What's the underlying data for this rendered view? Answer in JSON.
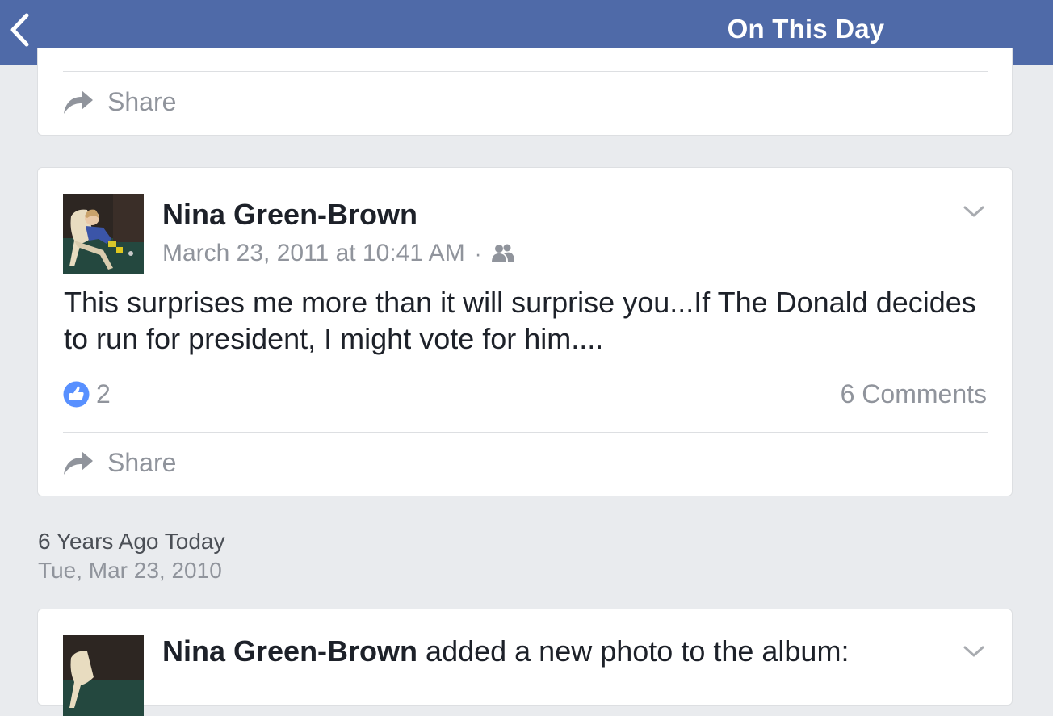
{
  "nav": {
    "title": "On This Day",
    "back_icon": "chevron-left-icon"
  },
  "top_card": {
    "share_label": "Share"
  },
  "post": {
    "author": "Nina Green-Brown",
    "timestamp": "March 23, 2011 at 10:41 AM",
    "separator": "·",
    "privacy_icon": "friends-icon",
    "text": "This surprises me more than it will surprise you...If The Donald decides to run for president, I might vote for him....",
    "like_count": "2",
    "comments_label": "6 Comments",
    "share_label": "Share"
  },
  "section": {
    "heading": "6 Years Ago Today",
    "date": "Tue, Mar 23, 2010"
  },
  "next_post": {
    "author": "Nina Green-Brown",
    "action_text": " added a new photo to the album:"
  },
  "colors": {
    "nav_bg": "#4f6aa8",
    "page_bg": "#e9ebee",
    "like_blue": "#5890ff",
    "text_dark": "#1d2129",
    "text_gray": "#90949c"
  }
}
